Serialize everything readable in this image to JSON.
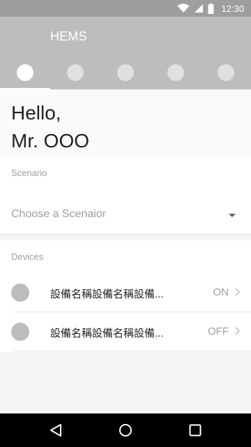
{
  "status_bar": {
    "time": "12:30",
    "icons": [
      "wifi-icon",
      "cellular-signal-icon",
      "battery-icon"
    ]
  },
  "app_bar": {
    "title": "HEMS",
    "tabs": [
      {
        "icon": "tab-dot-icon",
        "active": true
      },
      {
        "icon": "tab-dot-icon",
        "active": false
      },
      {
        "icon": "tab-dot-icon",
        "active": false
      },
      {
        "icon": "tab-dot-icon",
        "active": false
      },
      {
        "icon": "tab-dot-icon",
        "active": false
      }
    ]
  },
  "greeting": {
    "line1": "Hello,",
    "line2": "Mr. OOO"
  },
  "scenario": {
    "label": "Scenario",
    "select_placeholder": "Choose a Scenaior"
  },
  "devices": {
    "label": "Devices",
    "items": [
      {
        "name": "設備名稱設備名稱設備...",
        "state": "ON"
      },
      {
        "name": "設備名稱設備名稱設備...",
        "state": "OFF"
      }
    ]
  },
  "nav_bar": {
    "buttons": [
      "back-icon",
      "home-icon",
      "recents-icon"
    ]
  },
  "colors": {
    "status_bar": "#9e9e9e",
    "app_bar": "#bdbdbd",
    "accent_active": "#ffffff",
    "nav_bar": "#000000"
  }
}
